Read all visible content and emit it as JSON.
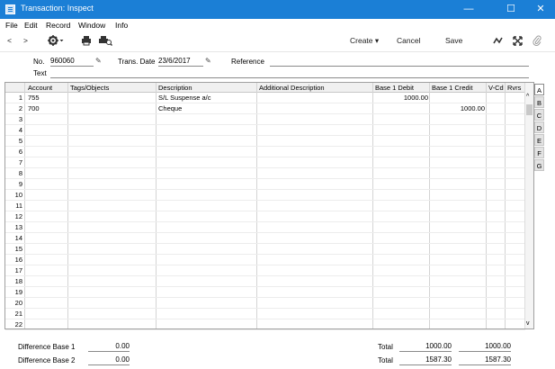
{
  "window": {
    "title": "Transaction: Inspect",
    "minimize": "—",
    "maximize": "☐",
    "close": "✕"
  },
  "menu": [
    "File",
    "Edit",
    "Record",
    "Window",
    "Info"
  ],
  "toolbar": {
    "prev": "<",
    "next": ">",
    "create_label": "Create",
    "create_arrow": "▾",
    "cancel_label": "Cancel",
    "save_label": "Save"
  },
  "header": {
    "no_label": "No.",
    "no_value": "960060",
    "date_label": "Trans. Date",
    "date_value": "23/6/2017",
    "reference_label": "Reference",
    "reference_value": "",
    "text_label": "Text",
    "text_value": ""
  },
  "grid": {
    "columns": [
      "Account",
      "Tags/Objects",
      "Description",
      "Additional Description",
      "Base 1 Debit",
      "Base 1 Credit",
      "V-Cd",
      "Rvrs"
    ],
    "rows": [
      {
        "n": "1",
        "account": "755",
        "tags": "",
        "description": "S/L Suspense a/c",
        "additional": "",
        "debit": "1000.00",
        "credit": "",
        "vcd": "",
        "rvrs": ""
      },
      {
        "n": "2",
        "account": "700",
        "tags": "",
        "description": "Cheque",
        "additional": "",
        "debit": "",
        "credit": "1000.00",
        "vcd": "",
        "rvrs": ""
      },
      {
        "n": "3"
      },
      {
        "n": "4"
      },
      {
        "n": "5"
      },
      {
        "n": "6"
      },
      {
        "n": "7"
      },
      {
        "n": "8"
      },
      {
        "n": "9"
      },
      {
        "n": "10"
      },
      {
        "n": "11"
      },
      {
        "n": "12"
      },
      {
        "n": "13"
      },
      {
        "n": "14"
      },
      {
        "n": "15"
      },
      {
        "n": "16"
      },
      {
        "n": "17"
      },
      {
        "n": "18"
      },
      {
        "n": "19"
      },
      {
        "n": "20"
      },
      {
        "n": "21"
      },
      {
        "n": "22"
      }
    ]
  },
  "tabs": [
    "A",
    "B",
    "C",
    "D",
    "E",
    "F",
    "G"
  ],
  "footer": {
    "diff1_label": "Difference Base 1",
    "diff1_value": "0.00",
    "diff2_label": "Difference Base 2",
    "diff2_value": "0.00",
    "total1_label": "Total",
    "total1_debit": "1000.00",
    "total1_credit": "1000.00",
    "total2_label": "Total",
    "total2_debit": "1587.30",
    "total2_credit": "1587.30"
  }
}
